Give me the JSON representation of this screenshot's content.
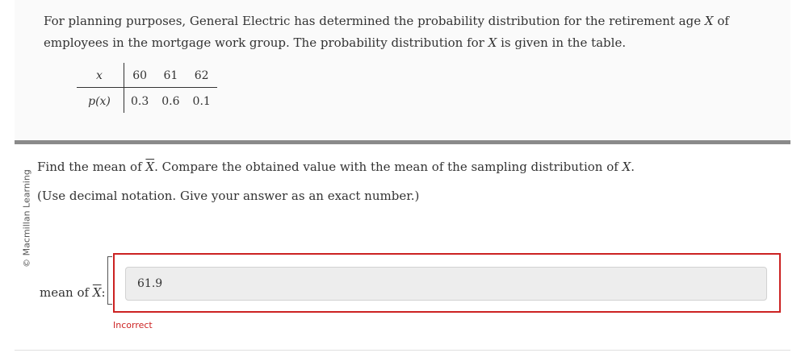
{
  "problem": {
    "intro_part1": "For planning purposes, General Electric has determined the probability distribution for the retirement age ",
    "intro_var1": "X",
    "intro_part2": " of employees in the mortgage work group. The probability distribution for ",
    "intro_var2": "X",
    "intro_part3": " is given in the table.",
    "table": {
      "x_header": "x",
      "p_header": "p(x)",
      "x_values": [
        "60",
        "61",
        "62"
      ],
      "p_values": [
        "0.3",
        "0.6",
        "0.1"
      ]
    }
  },
  "watermark": "© Macmillan Learning",
  "question": {
    "part1": "Find the mean of ",
    "var_bar": "X",
    "part2": ". Compare the obtained value with the mean of the sampling distribution of ",
    "var2": "X",
    "part3": ".",
    "instruction": "(Use decimal notation. Give your answer as an exact number.)"
  },
  "answer": {
    "label_prefix": "mean of ",
    "label_var": "X",
    "label_suffix": ":",
    "value": "61.9",
    "feedback": "Incorrect"
  },
  "colors": {
    "error": "#cc2222",
    "separator": "#8a8a8a",
    "input_bg": "#ededed"
  }
}
